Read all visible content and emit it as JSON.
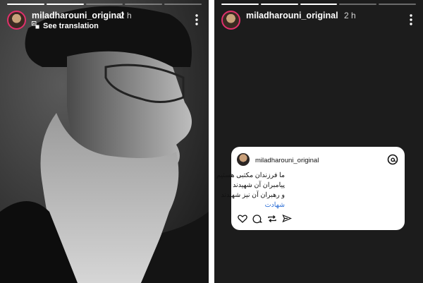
{
  "left_story": {
    "username": "miladharouni_original",
    "time": "2 h",
    "see_translation": "See translation"
  },
  "right_story": {
    "username": "miladharouni_original",
    "time": "2 h",
    "card": {
      "username": "miladharouni_original",
      "lines": [
        "ما فرزندان مکتبی هستیم که",
        "پیامبران آن شهیدند",
        "و رهبران آن نیز شهیدند"
      ],
      "hashtag": "شهادت"
    }
  },
  "colors": {
    "story_ring": "#e1306c",
    "hashtag": "#2d6fd6",
    "card_bg": "#ffffff"
  },
  "icons": [
    "more-vertical-icon",
    "translate-icon",
    "threads-icon",
    "heart-icon",
    "comment-icon",
    "repost-icon",
    "share-icon"
  ]
}
